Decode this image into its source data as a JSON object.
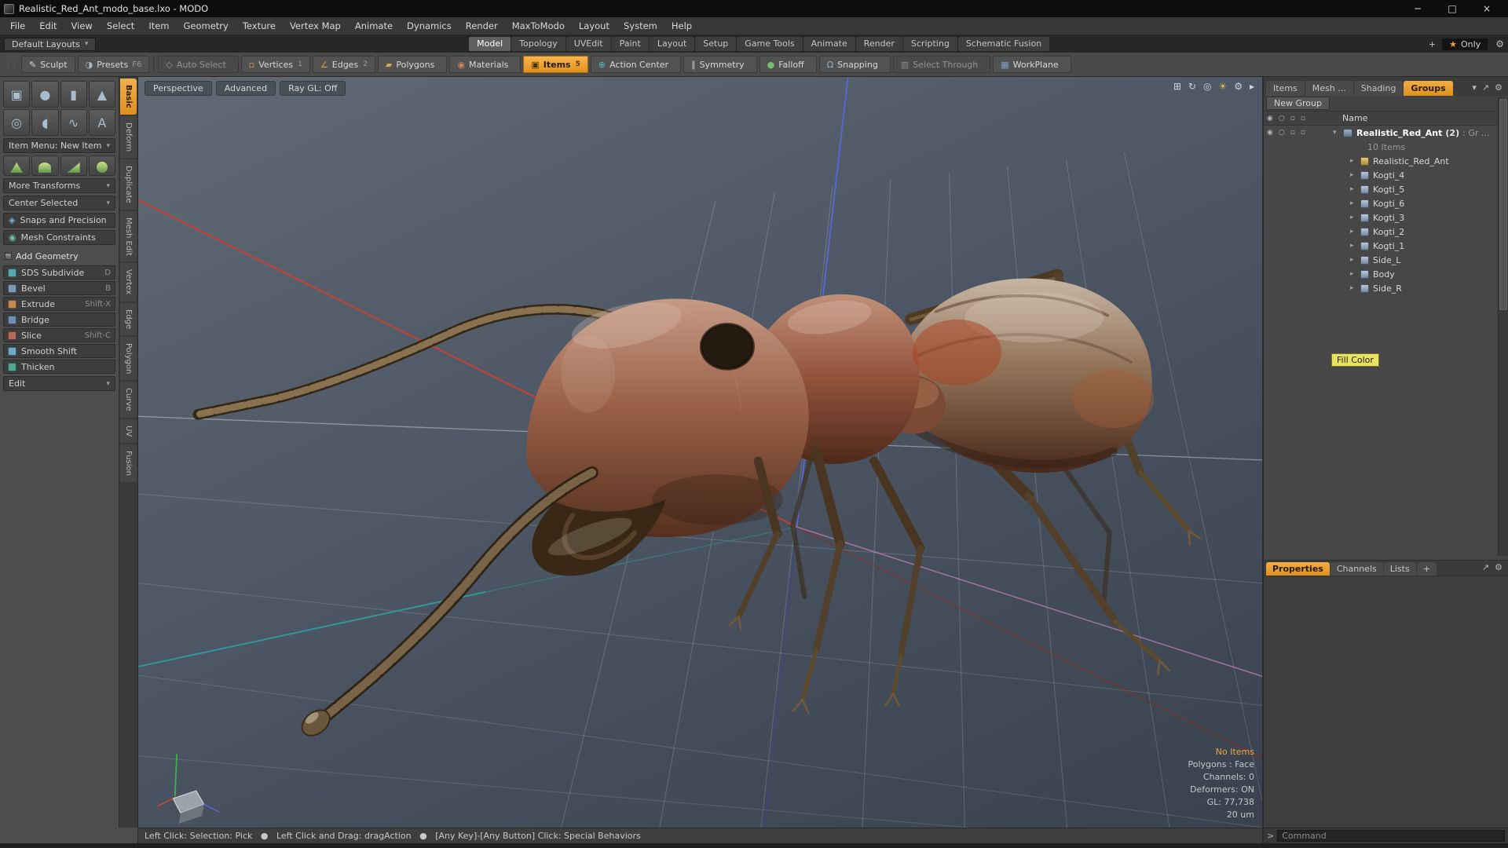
{
  "ui": {
    "carat": "▾",
    "expander": "▸",
    "window_min": "─",
    "window_max": "□",
    "window_close": "×"
  },
  "window": {
    "title": "Realistic_Red_Ant_modo_base.lxo - MODO"
  },
  "menu_bar": {
    "items": [
      "File",
      "Edit",
      "View",
      "Select",
      "Item",
      "Geometry",
      "Texture",
      "Vertex Map",
      "Animate",
      "Dynamics",
      "Render",
      "MaxToModo",
      "Layout",
      "System",
      "Help"
    ]
  },
  "layout_bar": {
    "presets_button": "Default Layouts",
    "tabs": [
      {
        "label": "Model",
        "active": true
      },
      {
        "label": "Topology"
      },
      {
        "label": "UVEdit"
      },
      {
        "label": "Paint"
      },
      {
        "label": "Layout"
      },
      {
        "label": "Setup"
      },
      {
        "label": "Game Tools"
      },
      {
        "label": "Animate"
      },
      {
        "label": "Render"
      },
      {
        "label": "Scripting"
      },
      {
        "label": "Schematic Fusion"
      }
    ],
    "add_tab": "+",
    "only_star": "★",
    "only_label": "Only",
    "gear_glyph": "⚙"
  },
  "toolbar": {
    "sculpt_label": "Sculpt",
    "sculpt_glyph": "✎",
    "presets_label": "Presets",
    "presets_glyph": "◑",
    "presets_shortcut": "F6",
    "modes": [
      {
        "label": "Auto Select",
        "icon": "auto-select",
        "glyph": "◇",
        "color": "#9a9a9a",
        "state": "dim"
      },
      {
        "label": "Vertices",
        "icon": "vertices",
        "glyph": "▫",
        "color": "#d8a050",
        "badge": "1"
      },
      {
        "label": "Edges",
        "icon": "edges",
        "glyph": "∠",
        "color": "#d8a050",
        "badge": "2"
      },
      {
        "label": "Polygons",
        "icon": "polygons",
        "glyph": "▰",
        "color": "#d8a050"
      },
      {
        "label": "Materials",
        "icon": "materials",
        "glyph": "◉",
        "color": "#c8825a"
      },
      {
        "label": "Items",
        "icon": "items",
        "glyph": "▣",
        "color": "#4a3000",
        "badge": "5",
        "active": true
      },
      {
        "label": "Action Center",
        "icon": "action-center",
        "glyph": "⊕",
        "color": "#55b8c8"
      },
      {
        "label": "Symmetry",
        "icon": "symmetry",
        "glyph": "∥",
        "color": "#c8c8c8"
      },
      {
        "label": "Falloff",
        "icon": "falloff",
        "glyph": "●",
        "color": "#7ac068"
      },
      {
        "label": "Snapping",
        "icon": "snapping",
        "glyph": "Ω",
        "color": "#9ab0c8"
      },
      {
        "label": "Select Through",
        "icon": "select-through",
        "glyph": "▥",
        "color": "#8a8a8a",
        "state": "dim"
      },
      {
        "label": "WorkPlane",
        "icon": "workplane",
        "glyph": "▦",
        "color": "#7aa2c8"
      }
    ]
  },
  "left_panel": {
    "tools": [
      {
        "icon": "cube",
        "glyph": "▣"
      },
      {
        "icon": "sphere",
        "glyph": "●"
      },
      {
        "icon": "cylinder",
        "glyph": "▮"
      },
      {
        "icon": "cone",
        "glyph": "▲"
      },
      {
        "icon": "torus",
        "glyph": "◎"
      },
      {
        "icon": "capsule",
        "glyph": "◖"
      },
      {
        "icon": "curve",
        "glyph": "∿"
      },
      {
        "icon": "text",
        "glyph": "A"
      }
    ],
    "item_menu_label": "Item Menu: New Item",
    "more_transforms_label": "More Transforms",
    "center_selected_label": "Center Selected",
    "snaps_label": "Snaps and Precision",
    "snaps_glyph": "◈",
    "mesh_constraints_label": "Mesh Constraints",
    "mesh_constraints_glyph": "◉",
    "add_geometry_header": "Add Geometry",
    "geometry_buttons": [
      {
        "label": "SDS Subdivide",
        "shortcut": "D",
        "icon_color": "#58a8b0"
      },
      {
        "label": "Bevel",
        "shortcut": "B",
        "icon_color": "#7a9ab8"
      },
      {
        "label": "Extrude",
        "shortcut": "Shift-X",
        "icon_color": "#c08a50"
      },
      {
        "label": "Bridge",
        "shortcut": "",
        "icon_color": "#6f8fb8"
      },
      {
        "label": "Slice",
        "shortcut": "Shift-C",
        "icon_color": "#b86a5a"
      },
      {
        "label": "Smooth Shift",
        "shortcut": "",
        "icon_color": "#6fa8c8"
      },
      {
        "label": "Thicken",
        "shortcut": "",
        "icon_color": "#50a890"
      }
    ],
    "edit_label": "Edit"
  },
  "side_tabs": [
    {
      "label": "Basic",
      "active": true
    },
    {
      "label": "Deform"
    },
    {
      "label": "Duplicate"
    },
    {
      "label": "Mesh Edit"
    },
    {
      "label": "Vertex"
    },
    {
      "label": "Edge"
    },
    {
      "label": "Polygon"
    },
    {
      "label": "Curve"
    },
    {
      "label": "UV"
    },
    {
      "label": "Fusion"
    }
  ],
  "viewport": {
    "buttons": [
      "Perspective",
      "Advanced",
      "Ray GL: Off"
    ],
    "icons": [
      {
        "icon": "pan",
        "glyph": "⊞"
      },
      {
        "icon": "rotate",
        "glyph": "↻"
      },
      {
        "icon": "zoom",
        "glyph": "◎"
      },
      {
        "icon": "light",
        "glyph": "☀",
        "color": "#e2bd5e"
      },
      {
        "icon": "gear",
        "glyph": "⚙"
      },
      {
        "icon": "menu-arrow",
        "glyph": "▸"
      }
    ],
    "info_no_items": "No Items",
    "info_lines": [
      "Polygons : Face",
      "Channels: 0",
      "Deformers: ON",
      "GL: 77,738",
      "20 um"
    ]
  },
  "right_panel": {
    "tabs": [
      {
        "label": "Items"
      },
      {
        "label": "Mesh ..."
      },
      {
        "label": "Shading"
      },
      {
        "label": "Groups",
        "active": true
      }
    ],
    "tab_icons": {
      "chevron": "▾",
      "expand": "↗",
      "gear": "⚙"
    },
    "new_group_label": "New Group",
    "name_header": "Name",
    "col_icons": [
      "◉",
      "○",
      "▫",
      "▫"
    ],
    "group_row": {
      "label": "Realistic_Red_Ant",
      "count": "(2)",
      "suffix": ": Gr ...",
      "items_line": "10 Items"
    },
    "tree_items": [
      "Realistic_Red_Ant",
      "Kogti_4",
      "Kogti_5",
      "Kogti_6",
      "Kogti_3",
      "Kogti_2",
      "Kogti_1",
      "Side_L",
      "Body",
      "Side_R"
    ],
    "tooltip": "Fill Color",
    "bottom_tabs": [
      {
        "label": "Properties",
        "active": true
      },
      {
        "label": "Channels"
      },
      {
        "label": "Lists"
      },
      {
        "label": "+"
      }
    ]
  },
  "status_bar": {
    "text": "Left Click: Selection: Pick   ●   Left Click and Drag: dragAction   ●   [Any Key]-[Any Button] Click: Special Behaviors"
  },
  "command": {
    "prompt": ">",
    "placeholder": "Command"
  }
}
